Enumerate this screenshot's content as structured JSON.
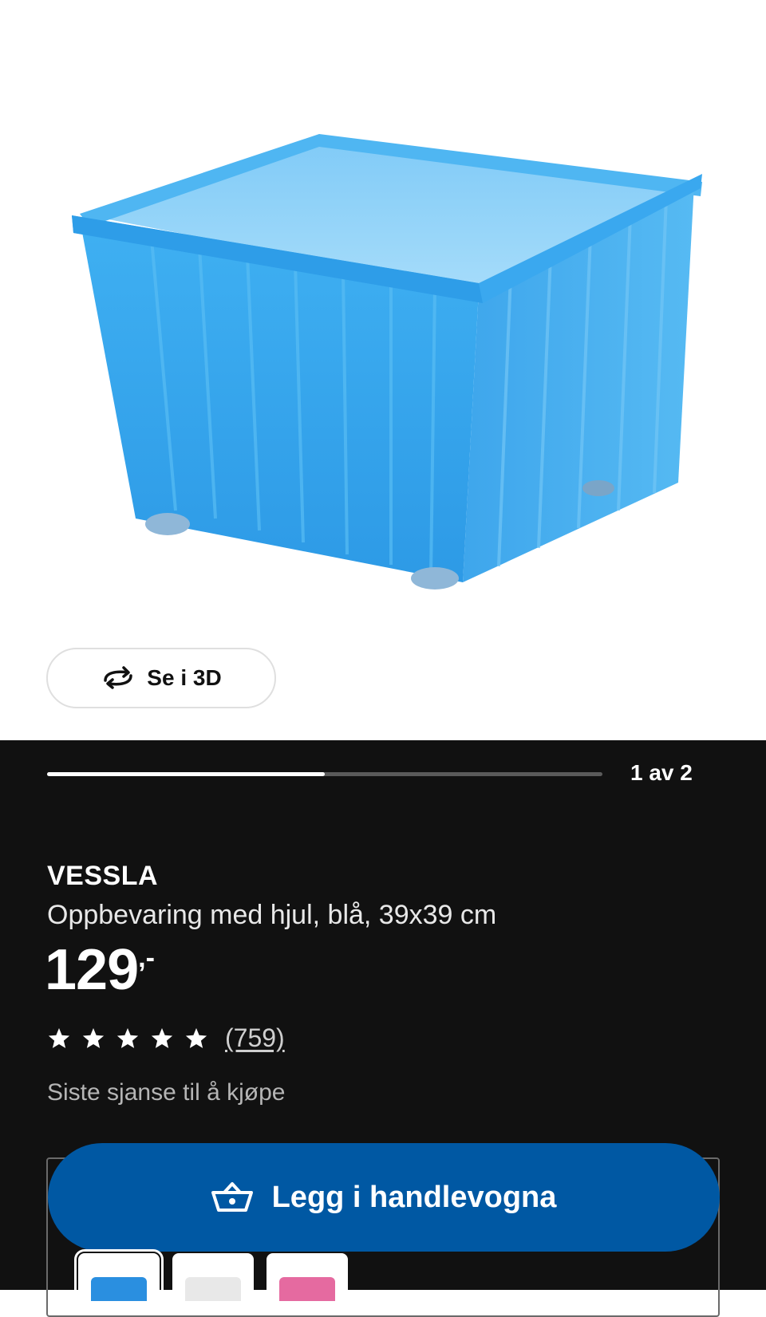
{
  "gallery": {
    "view_3d_label": "Se i 3D",
    "counter": "1 av 2",
    "progress": 0.5
  },
  "product": {
    "name": "VESSLA",
    "description": "Oppbevaring med hjul, blå, 39x39 cm",
    "price": "129",
    "price_suffix": ",-",
    "rating": 5,
    "review_count": "(759)",
    "notice": "Siste sjanse til å kjøpe"
  },
  "actions": {
    "add_to_cart_label": "Legg i handlevogna"
  },
  "variants": [
    {
      "color": "#2a8fe0",
      "selected": true
    },
    {
      "color": "#e8e8e8",
      "selected": false
    },
    {
      "color": "#e56aa0",
      "selected": false
    }
  ],
  "colors": {
    "panel_bg": "#111111",
    "cart_button": "#0058a3",
    "product_blue": "#3aa8ef"
  }
}
